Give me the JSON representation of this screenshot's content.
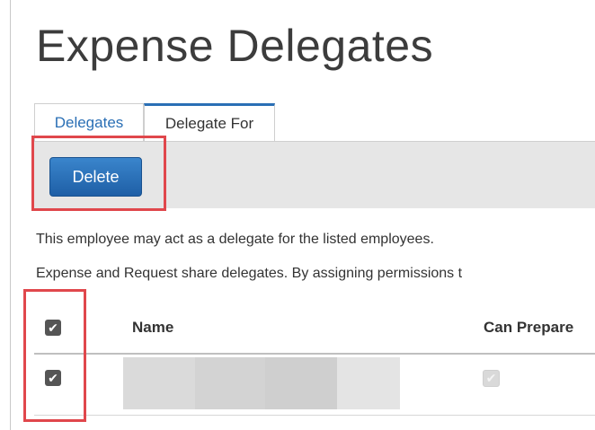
{
  "page": {
    "title": "Expense Delegates"
  },
  "tabs": [
    {
      "label": "Delegates",
      "active": false
    },
    {
      "label": "Delegate For",
      "active": true
    }
  ],
  "toolbar": {
    "delete_label": "Delete"
  },
  "info": {
    "line1": "This employee may act as a delegate for the listed employees.",
    "line2": "Expense and Request share delegates. By assigning permissions t"
  },
  "table": {
    "columns": {
      "name": "Name",
      "can_prepare": "Can Prepare"
    },
    "header_checkbox": "✔",
    "rows": [
      {
        "checkbox": "✔",
        "name_redacted": true,
        "can_prepare": "✔"
      }
    ]
  },
  "colors": {
    "accent": "#2a6fb5",
    "highlight": "#e0474c",
    "toolbar_bg": "#e6e6e6"
  }
}
